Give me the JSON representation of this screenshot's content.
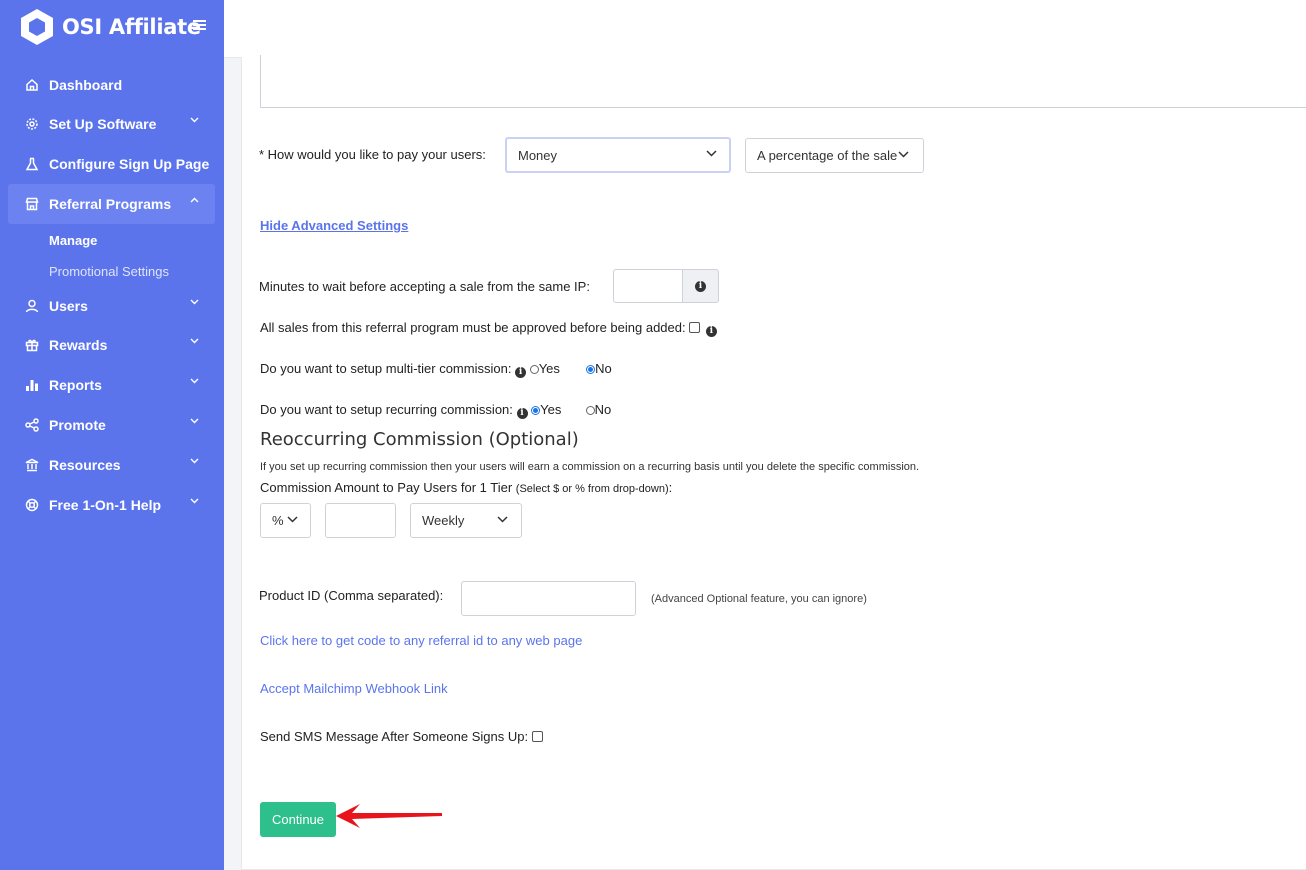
{
  "app": {
    "title": "OSI Affiliate"
  },
  "sidebar": {
    "items": [
      {
        "label": "Dashboard",
        "icon": "home-icon"
      },
      {
        "label": "Set Up Software",
        "icon": "gear-icon"
      },
      {
        "label": "Configure Sign Up Page",
        "icon": "flask-icon"
      },
      {
        "label": "Referral Programs",
        "icon": "store-icon",
        "active": true
      },
      {
        "label": "Users",
        "icon": "user-icon"
      },
      {
        "label": "Rewards",
        "icon": "gift-icon"
      },
      {
        "label": "Reports",
        "icon": "bar-chart-icon"
      },
      {
        "label": "Promote",
        "icon": "share-icon"
      },
      {
        "label": "Resources",
        "icon": "bank-icon"
      },
      {
        "label": "Free 1-On-1 Help",
        "icon": "lifebuoy-icon"
      }
    ],
    "subitems": [
      {
        "label": "Manage",
        "active": true
      },
      {
        "label": "Promotional Settings"
      }
    ]
  },
  "form": {
    "pay_label": "* How would you like to pay your users:",
    "pay_method": "Money",
    "pay_type": "A percentage of the sale",
    "advanced_link": "Hide Advanced Settings",
    "minutes_label": "Minutes to wait before accepting a sale from the same IP:",
    "minutes_value": "",
    "approve_label": "All sales from this referral program must be approved before being added:",
    "multitier_label": "Do you want to setup multi-tier commission:",
    "multitier_yes": "Yes",
    "multitier_no": "No",
    "multitier_selected": "No",
    "recurring_label": "Do you want to setup recurring commission:",
    "recurring_yes": "Yes",
    "recurring_no": "No",
    "recurring_selected": "Yes",
    "reoccurring_heading": "Reoccurring Commission (Optional)",
    "reoccurring_desc": "If you set up recurring commission then your users will earn a commission on a recurring basis until you delete the specific commission.",
    "commission_label": "Commission Amount to Pay Users for 1 Tier",
    "commission_hint": "(Select $ or % from drop-down)",
    "commission_colon": ":",
    "commission_unit": "%",
    "commission_amount": "",
    "commission_frequency": "Weekly",
    "product_label": "Product ID (Comma separated):",
    "product_value": "",
    "product_hint": "(Advanced Optional feature, you can ignore)",
    "code_link": "Click here to get code to any referral id to any web page",
    "mailchimp_link": "Accept Mailchimp Webhook Link",
    "sms_label": "Send SMS Message After Someone Signs Up:",
    "continue_label": "Continue"
  },
  "colors": {
    "sidebar": "#5b74ec",
    "primary_button": "#2ec08c",
    "link": "#5b74ec",
    "annotation_arrow": "#e8141b"
  }
}
